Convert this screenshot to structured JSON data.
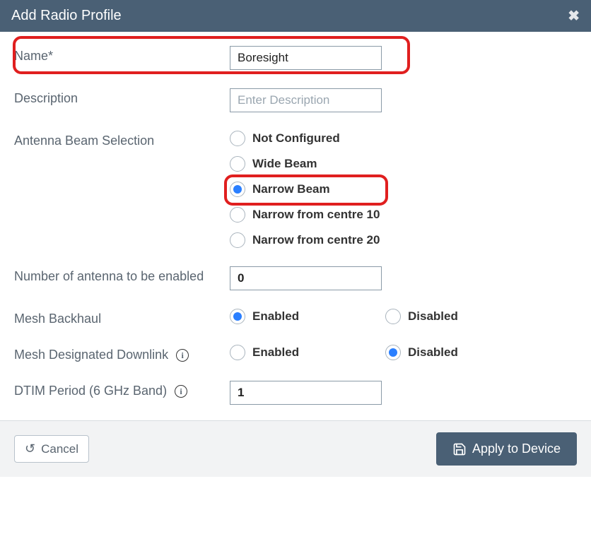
{
  "title": "Add Radio Profile",
  "fields": {
    "name_label": "Name*",
    "name_value": "Boresight",
    "description_label": "Description",
    "description_placeholder": "Enter Description",
    "description_value": "",
    "antenna_label": "Antenna Beam Selection",
    "antenna_options": {
      "not_configured": "Not Configured",
      "wide_beam": "Wide Beam",
      "narrow_beam": "Narrow Beam",
      "narrow_10": "Narrow from centre 10",
      "narrow_20": "Narrow from centre 20"
    },
    "antenna_selected": "narrow_beam",
    "num_antenna_label": "Number of antenna to be enabled",
    "num_antenna_value": "0",
    "mesh_backhaul_label": "Mesh Backhaul",
    "mesh_backhaul_enabled": "Enabled",
    "mesh_backhaul_disabled": "Disabled",
    "mesh_backhaul_selected": "enabled",
    "mesh_downlink_label": "Mesh Designated Downlink",
    "mesh_downlink_enabled": "Enabled",
    "mesh_downlink_disabled": "Disabled",
    "mesh_downlink_selected": "disabled",
    "dtim_label": "DTIM Period (6 GHz Band)",
    "dtim_value": "1"
  },
  "buttons": {
    "cancel": "Cancel",
    "apply": "Apply to Device"
  },
  "info_glyph": "i"
}
